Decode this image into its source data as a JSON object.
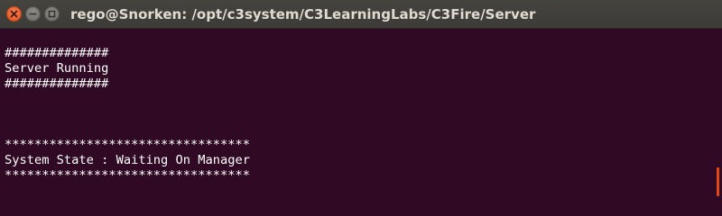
{
  "window": {
    "title": "rego@Snorken: /opt/c3system/C3LearningLabs/C3Fire/Server",
    "buttons": [
      {
        "name": "close",
        "icon": "close-icon",
        "color": "#e2541e"
      },
      {
        "name": "minimize",
        "icon": "minimize-icon",
        "color": "#6b6a65"
      },
      {
        "name": "maximize",
        "icon": "maximize-icon",
        "color": "#6b6a65"
      }
    ]
  },
  "terminal": {
    "background": "#300a24",
    "foreground": "#ffffff",
    "lines": [
      "##############",
      "Server Running",
      "##############",
      "",
      "",
      "",
      "*********************************",
      "System State : Waiting On Manager",
      "*********************************"
    ]
  },
  "scrollbar": {
    "accent": "#dd4814"
  }
}
